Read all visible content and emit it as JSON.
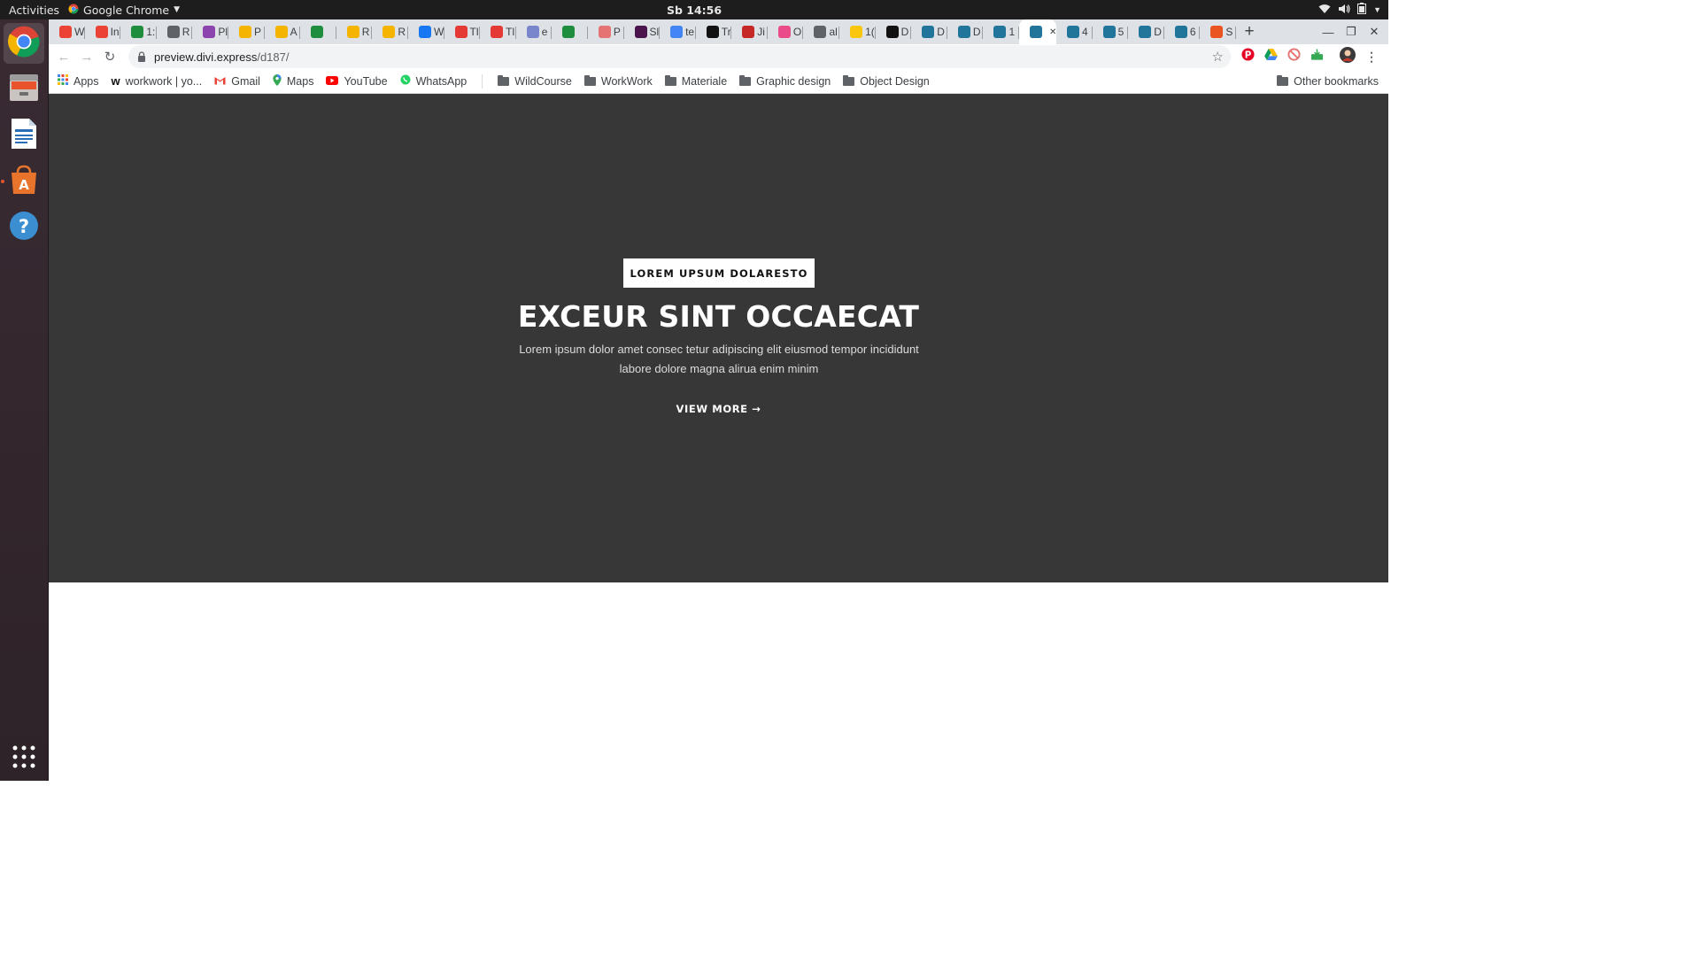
{
  "topbar": {
    "activities": "Activities",
    "app_name": "Google Chrome",
    "clock": "Sb 14:56"
  },
  "dock": {
    "items": [
      "chrome-icon",
      "files-icon",
      "writer-icon",
      "software-center-icon",
      "help-icon"
    ],
    "show_apps": "show-applications-icon"
  },
  "tabs": [
    {
      "icon": "gmail-icon",
      "label": "W",
      "color": "#ea4335"
    },
    {
      "icon": "gmail-icon",
      "label": "In",
      "color": "#ea4335"
    },
    {
      "icon": "green-circle-icon",
      "label": "1:",
      "color": "#1e8e3e"
    },
    {
      "icon": "gear-circle-icon",
      "label": "R",
      "color": "#5f6368"
    },
    {
      "icon": "purple-icon",
      "label": "Pl",
      "color": "#8e44ad"
    },
    {
      "icon": "slides-icon",
      "label": "P",
      "color": "#f4b400"
    },
    {
      "icon": "slides-icon",
      "label": "A",
      "color": "#f4b400"
    },
    {
      "icon": "chat-icon",
      "label": "",
      "color": "#1e8e3e"
    },
    {
      "icon": "slides-icon",
      "label": "R",
      "color": "#f4b400"
    },
    {
      "icon": "slides-icon",
      "label": "R",
      "color": "#f4b400"
    },
    {
      "icon": "facebook-icon",
      "label": "W",
      "color": "#1877f2"
    },
    {
      "icon": "trend-icon",
      "label": "Tl",
      "color": "#e53935"
    },
    {
      "icon": "trend-icon",
      "label": "Tl",
      "color": "#e53935"
    },
    {
      "icon": "doc-icon",
      "label": "e",
      "color": "#7986cb"
    },
    {
      "icon": "chat-icon",
      "label": "",
      "color": "#1e8e3e"
    },
    {
      "icon": "pattern-icon",
      "label": "P",
      "color": "#e57373"
    },
    {
      "icon": "slack-icon",
      "label": "Sl",
      "color": "#4a154b"
    },
    {
      "icon": "google-icon",
      "label": "te",
      "color": "#4285f4"
    },
    {
      "icon": "behance-icon",
      "label": "Tr",
      "color": "#111111"
    },
    {
      "icon": "grid-icon",
      "label": "Ji",
      "color": "#c62828"
    },
    {
      "icon": "dribbble-icon",
      "label": "O",
      "color": "#ea4c89"
    },
    {
      "icon": "globe-icon",
      "label": "al",
      "color": "#5f6368"
    },
    {
      "icon": "yellow-icon",
      "label": "1(",
      "color": "#f9c80e"
    },
    {
      "icon": "e-icon",
      "label": "D",
      "color": "#111111"
    },
    {
      "icon": "wordpress-icon",
      "label": "D",
      "color": "#21759b"
    },
    {
      "icon": "wordpress-icon",
      "label": "D",
      "color": "#21759b"
    },
    {
      "icon": "wordpress-icon",
      "label": "1",
      "color": "#21759b"
    },
    {
      "icon": "wordpress-icon",
      "label": "",
      "color": "#21759b",
      "active": true
    },
    {
      "icon": "wordpress-icon",
      "label": "4",
      "color": "#21759b"
    },
    {
      "icon": "wordpress-icon",
      "label": "5",
      "color": "#21759b"
    },
    {
      "icon": "wordpress-icon",
      "label": "D",
      "color": "#21759b"
    },
    {
      "icon": "wordpress-icon",
      "label": "6",
      "color": "#21759b"
    },
    {
      "icon": "ubuntu-icon",
      "label": "S",
      "color": "#e95420"
    }
  ],
  "toolbar": {
    "url_host": "preview.divi.express",
    "url_path": "/d187/"
  },
  "bookmarks": {
    "apps": "Apps",
    "items": [
      {
        "label": "workwork | yo...",
        "icon": "workwork-icon"
      },
      {
        "label": "Gmail",
        "icon": "gmail-icon"
      },
      {
        "label": "Maps",
        "icon": "maps-icon"
      },
      {
        "label": "YouTube",
        "icon": "youtube-icon"
      },
      {
        "label": "WhatsApp",
        "icon": "whatsapp-icon"
      }
    ],
    "folders": [
      "WildCourse",
      "WorkWork",
      "Materiale",
      "Graphic design",
      "Object Design"
    ],
    "other": "Other bookmarks"
  },
  "hero": {
    "badge": "LOREM UPSUM DOLARESTO",
    "headline": "EXCEUR SINT OCCAECAT",
    "description": "Lorem ipsum dolor amet consec tetur adipiscing elit eiusmod tempor incididunt labore dolore magna alirua enim minim",
    "cta": "VIEW MORE →",
    "background": "#373737"
  }
}
